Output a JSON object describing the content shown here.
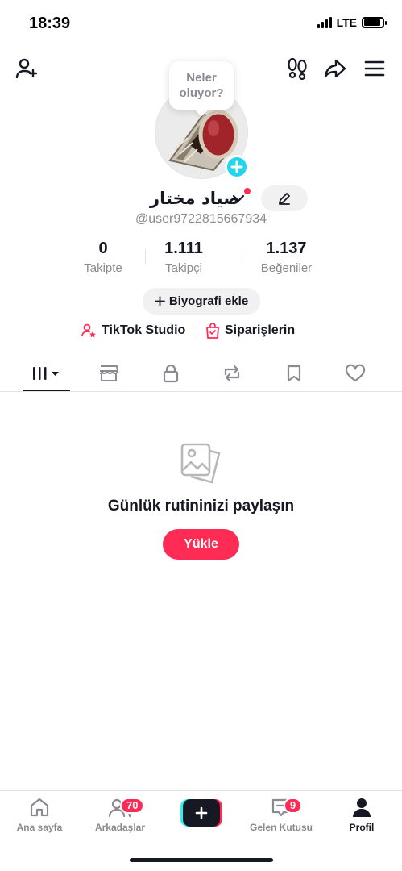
{
  "status_bar": {
    "time": "18:39",
    "network": "LTE",
    "signal_bars": 4,
    "battery_level": 0.9
  },
  "top_bar": {
    "icons": [
      "add-friend-icon",
      "footprints-icon",
      "share-icon",
      "menu-icon"
    ]
  },
  "profile": {
    "story_bubble": "Neler oluyor?",
    "display_name": "صياد مختار",
    "username": "@user9722815667934",
    "stats": [
      {
        "value": "0",
        "label": "Takipte"
      },
      {
        "value": "1.111",
        "label": "Takipçi"
      },
      {
        "value": "1.137",
        "label": "Beğeniler"
      }
    ],
    "bio_button": "Biyografi ekle",
    "links": {
      "studio": "TikTok Studio",
      "orders": "Siparişlerin"
    }
  },
  "tabs": [
    "videos-grid-icon",
    "shop-icon",
    "lock-icon",
    "repost-icon",
    "bookmark-icon",
    "heart-icon"
  ],
  "empty_state": {
    "title": "Günlük rutininizi paylaşın",
    "button": "Yükle"
  },
  "bottom_nav": {
    "home": "Ana sayfa",
    "friends": "Arkadaşlar",
    "friends_badge": "70",
    "inbox": "Gelen Kutusu",
    "inbox_badge": "9",
    "profile": "Profil"
  },
  "colors": {
    "accent": "#fe2c55",
    "cyan": "#25f4ee",
    "plus_badge": "#20d5ec",
    "text": "#161823",
    "muted": "#8a8b91"
  }
}
